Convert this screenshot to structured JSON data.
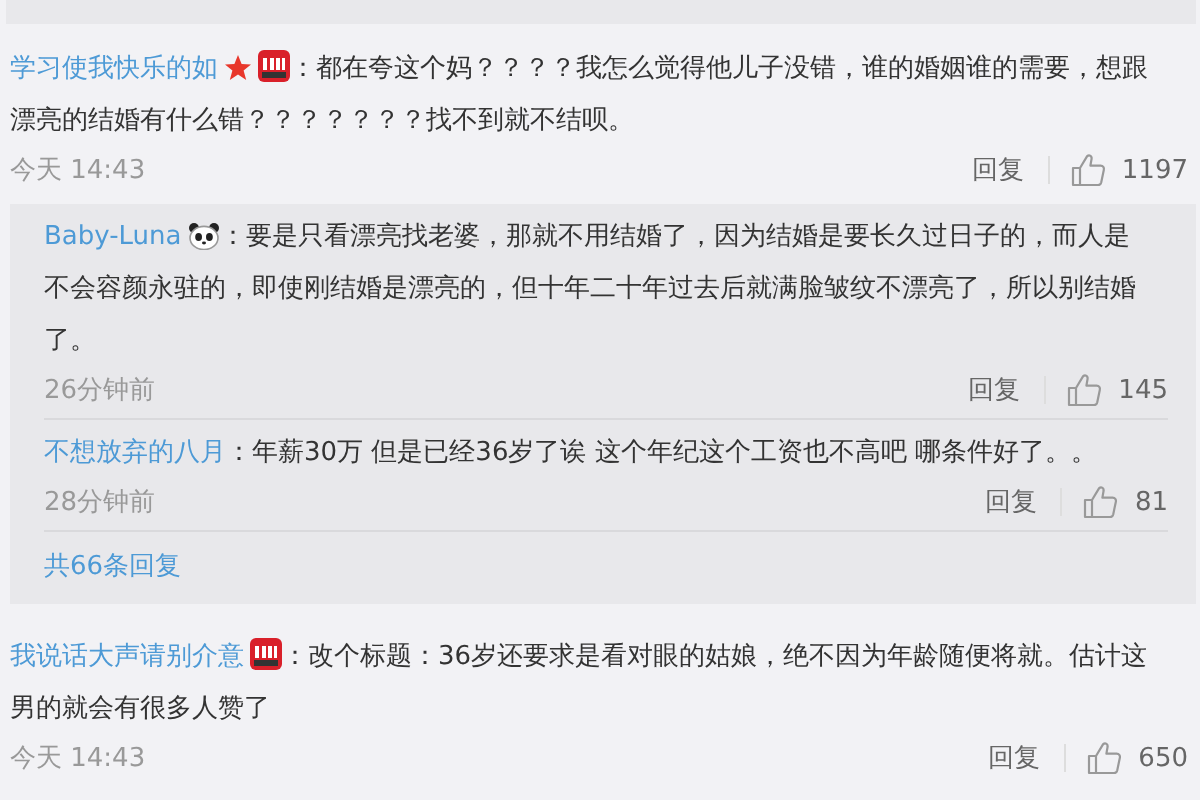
{
  "comments": [
    {
      "author": "学习使我快乐的如",
      "badges": [
        {
          "kind": "star"
        },
        {
          "kind": "tag"
        }
      ],
      "text": "：都在夸这个妈？？？？我怎么觉得他儿子没错，谁的婚姻谁的需要，想跟漂亮的结婚有什么错？？？？？？？找不到就不结呗。",
      "time": "今天 14:43",
      "reply_label": "回复",
      "likes": "1197",
      "replies": {
        "items": [
          {
            "author": "Baby-Luna",
            "badges": [
              {
                "kind": "panda"
              }
            ],
            "text": "：要是只看漂亮找老婆，那就不用结婚了，因为结婚是要长久过日子的，而人是不会容颜永驻的，即使刚结婚是漂亮的，但十年二十年过去后就满脸皱纹不漂亮了，所以别结婚了。",
            "time": "26分钟前",
            "reply_label": "回复",
            "likes": "145"
          },
          {
            "author": "不想放弃的八月",
            "text": "：年薪30万 但是已经36岁了诶 这个年纪这个工资也不高吧 哪条件好了。。",
            "time": "28分钟前",
            "reply_label": "回复",
            "likes": "81"
          }
        ],
        "more": "共66条回复"
      }
    },
    {
      "author": "我说话大声请别介意",
      "badges": [
        {
          "kind": "tag"
        }
      ],
      "text": "：改个标题：36岁还要求是看对眼的姑娘，绝不因为年龄随便将就。估计这男的就会有很多人赞了",
      "time": "今天 14:43",
      "reply_label": "回复",
      "likes": "650"
    }
  ]
}
